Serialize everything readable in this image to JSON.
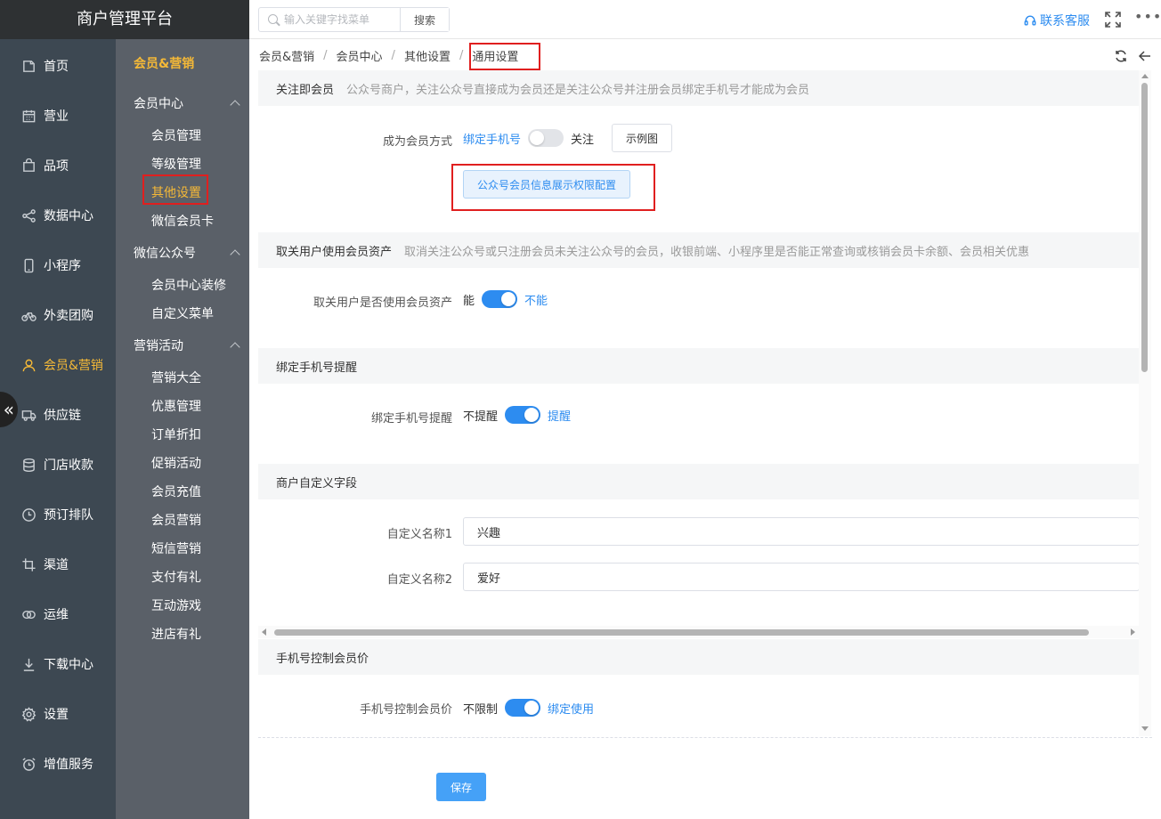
{
  "app": {
    "title": "商户管理平台"
  },
  "rail": {
    "items": [
      {
        "label": "首页",
        "icon": "home-icon"
      },
      {
        "label": "营业",
        "icon": "calendar-icon"
      },
      {
        "label": "品项",
        "icon": "bag-icon"
      },
      {
        "label": "数据中心",
        "icon": "share-icon"
      },
      {
        "label": "小程序",
        "icon": "phone-icon"
      },
      {
        "label": "外卖团购",
        "icon": "bike-icon"
      },
      {
        "label": "会员&营销",
        "icon": "user-icon",
        "active": true
      },
      {
        "label": "供应链",
        "icon": "truck-icon"
      },
      {
        "label": "门店收款",
        "icon": "database-icon"
      },
      {
        "label": "预订排队",
        "icon": "clock-icon"
      },
      {
        "label": "渠道",
        "icon": "crop-icon"
      },
      {
        "label": "运维",
        "icon": "link-icon"
      },
      {
        "label": "下载中心",
        "icon": "download-icon"
      },
      {
        "label": "设置",
        "icon": "gear-icon"
      },
      {
        "label": "增值服务",
        "icon": "alarm-icon"
      }
    ]
  },
  "submenu": {
    "title": "会员&营销",
    "groups": [
      {
        "label": "会员中心",
        "items": [
          "会员管理",
          "等级管理",
          "其他设置",
          "微信会员卡"
        ]
      },
      {
        "label": "微信公众号",
        "items": [
          "会员中心装修",
          "自定义菜单"
        ]
      },
      {
        "label": "营销活动",
        "items": [
          "营销大全",
          "优惠管理",
          "订单折扣",
          "促销活动",
          "会员充值",
          "会员营销",
          "短信营销",
          "支付有礼",
          "互动游戏",
          "进店有礼"
        ]
      }
    ],
    "active_item": "其他设置"
  },
  "topbar": {
    "search_placeholder": "输入关键字找菜单",
    "search_button": "搜索",
    "service_label": "联系客服"
  },
  "breadcrumb": [
    "会员&营销",
    "会员中心",
    "其他设置",
    "通用设置"
  ],
  "sections": {
    "follow": {
      "title": "关注即会员",
      "desc": "公众号商户，关注公众号直接成为会员还是关注公众号并注册会员绑定手机号才能成为会员",
      "row_label": "成为会员方式",
      "left_option": "绑定手机号",
      "right_option": "关注",
      "switch_on": false,
      "example_button": "示例图",
      "config_button": "公众号会员信息展示权限配置"
    },
    "unfollow": {
      "title": "取关用户使用会员资产",
      "desc": "取消关注公众号或只注册会员未关注公众号的会员，收银前端、小程序里是否能正常查询或核销会员卡余额、会员相关优惠",
      "row_label": "取关用户是否使用会员资产",
      "left_option": "能",
      "right_option": "不能",
      "switch_on": true
    },
    "bind_remind": {
      "title": "绑定手机号提醒",
      "row_label": "绑定手机号提醒",
      "left_option": "不提醒",
      "right_option": "提醒",
      "switch_on": true
    },
    "custom_fields": {
      "title": "商户自定义字段",
      "field1_label": "自定义名称1",
      "field1_value": "兴趣",
      "field2_label": "自定义名称2",
      "field2_value": "爱好"
    },
    "phone_price": {
      "title": "手机号控制会员价",
      "row_label": "手机号控制会员价",
      "left_option": "不限制",
      "right_option": "绑定使用",
      "switch_on": true
    }
  },
  "footer": {
    "save_button": "保存"
  },
  "colors": {
    "accent": "#2d8cf0",
    "active_menu": "#f5b937",
    "highlight_box": "#e01f1f"
  }
}
